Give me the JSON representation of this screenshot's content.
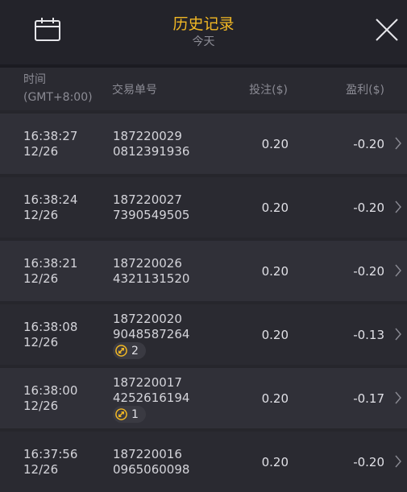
{
  "header": {
    "title": "历史记录",
    "subtitle": "今天",
    "calendar_icon": "calendar-icon",
    "close_icon": "close-icon"
  },
  "columns": {
    "time_label": "时间",
    "timezone_label": "(GMT+8:00)",
    "order_label": "交易单号",
    "bet_label": "投注($)",
    "profit_label": "盈利($)"
  },
  "rows": [
    {
      "time": "16:38:27",
      "date": "12/26",
      "order_line1": "187220029",
      "order_line2": "0812391936",
      "bet": "0.20",
      "profit": "-0.20",
      "badge": null
    },
    {
      "time": "16:38:24",
      "date": "12/26",
      "order_line1": "187220027",
      "order_line2": "7390549505",
      "bet": "0.20",
      "profit": "-0.20",
      "badge": null
    },
    {
      "time": "16:38:21",
      "date": "12/26",
      "order_line1": "187220026",
      "order_line2": "4321131520",
      "bet": "0.20",
      "profit": "-0.20",
      "badge": null
    },
    {
      "time": "16:38:08",
      "date": "12/26",
      "order_line1": "187220020",
      "order_line2": "9048587264",
      "bet": "0.20",
      "profit": "-0.13",
      "badge": "2"
    },
    {
      "time": "16:38:00",
      "date": "12/26",
      "order_line1": "187220017",
      "order_line2": "4252616194",
      "bet": "0.20",
      "profit": "-0.17",
      "badge": "1"
    },
    {
      "time": "16:37:56",
      "date": "12/26",
      "order_line1": "187220016",
      "order_line2": "0965060098",
      "bet": "0.20",
      "profit": "-0.20",
      "badge": null
    }
  ],
  "colors": {
    "accent": "#f2b824",
    "background": "#2a2a31",
    "header_bg": "#23232a"
  }
}
